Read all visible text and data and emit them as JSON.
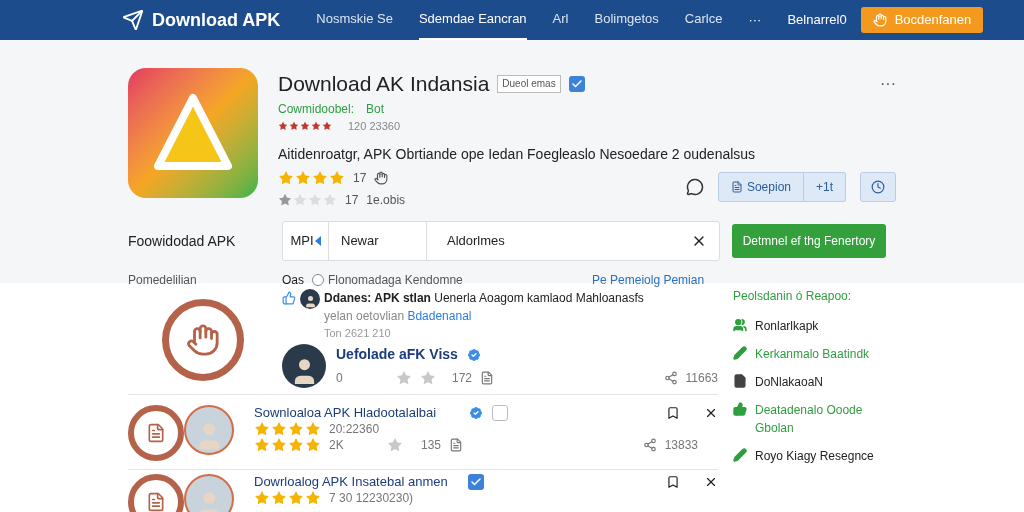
{
  "header": {
    "logo": "Download APK",
    "nav": [
      {
        "label": "Nosmskie Se",
        "selected": false
      },
      {
        "label": "Sdemdae Eancran",
        "selected": true
      },
      {
        "label": "Arl",
        "selected": false
      },
      {
        "label": "Bolimgetos",
        "selected": false
      },
      {
        "label": "Carlce",
        "selected": false
      }
    ],
    "more": "···",
    "account": "Belnarrel0",
    "cta": "Bocdenfanen"
  },
  "app": {
    "title": "Download AK Indansia",
    "badge": "Dueol emas",
    "verified": true,
    "developer": "Cowmidoobel:",
    "developer_tag": "Bot",
    "rating_small": {
      "stars": 5,
      "text": "120 23360"
    },
    "description": "Aitidenroatgr, APK Obrtiande ope Iedan Foegleaslo Nesoedare 2 oudenalsus",
    "rating": {
      "stars": 4,
      "count": "17"
    },
    "rating_muted": {
      "stars": 1,
      "count": "17",
      "text": "1e.obis"
    },
    "more": "···",
    "actions": [
      "Soepion",
      "+1t"
    ]
  },
  "search": {
    "label": "Foowidodad APK",
    "prefix": "MPI",
    "segment": "Newar",
    "value": "Aldorlmes",
    "button": "Detmnel ef thg Fenertory"
  },
  "filters": {
    "label": "Pomedelilian",
    "option_a": "Oas",
    "option_b": {
      "label": "Flonomadaga Kendomne",
      "selected": false
    },
    "link": "Pe Pemeiolg Pemian"
  },
  "posts": [
    {
      "kind": "post",
      "author": "Ddanes: APK stlan",
      "text": "Uenerla Aoagom kamlaod Mahloanasfs",
      "subtitle": "yelan oetovlian",
      "link": "Bdadenanal",
      "date": "Ton 2621 210",
      "name": "Uefolade aFK Viss",
      "verified": true,
      "stat_a": "0",
      "stat_b": "172",
      "stat_c": "11663"
    },
    {
      "kind": "app",
      "name": "Sownloaloa APK Hladootalalbai",
      "verified": true,
      "checked": false,
      "stars": 4,
      "line_a": "20:22360",
      "rating_b": {
        "stars": 4,
        "count": "2K"
      },
      "stat_b": "135",
      "stat_c": "13833"
    },
    {
      "kind": "app",
      "name": "Dowrloalog APK Insatebal anmen",
      "verified": false,
      "checked": true,
      "stars": 4,
      "line_a": "7 30 12230230)"
    }
  ],
  "sidebar": {
    "title": "Peolsdanin ó Reapoo:",
    "items": [
      {
        "kind": "people",
        "label": "Ronlarlkapk",
        "color": "#2e9e3e",
        "highlight": false
      },
      {
        "kind": "pencil",
        "label": "Kerkanmalo Baatindk",
        "color": "#2e9e3e",
        "highlight": true
      },
      {
        "kind": "doc",
        "label": "DoNlakaoaN",
        "color": "#444444",
        "highlight": false
      },
      {
        "kind": "thumb",
        "label": "Deatadenalo Ooode Gbolan",
        "color": "#2e9e3e",
        "highlight": true
      },
      {
        "kind": "pencil",
        "label": "Royo Kiagy Resegnce",
        "color": "#2e9e3e",
        "highlight": false
      }
    ]
  }
}
